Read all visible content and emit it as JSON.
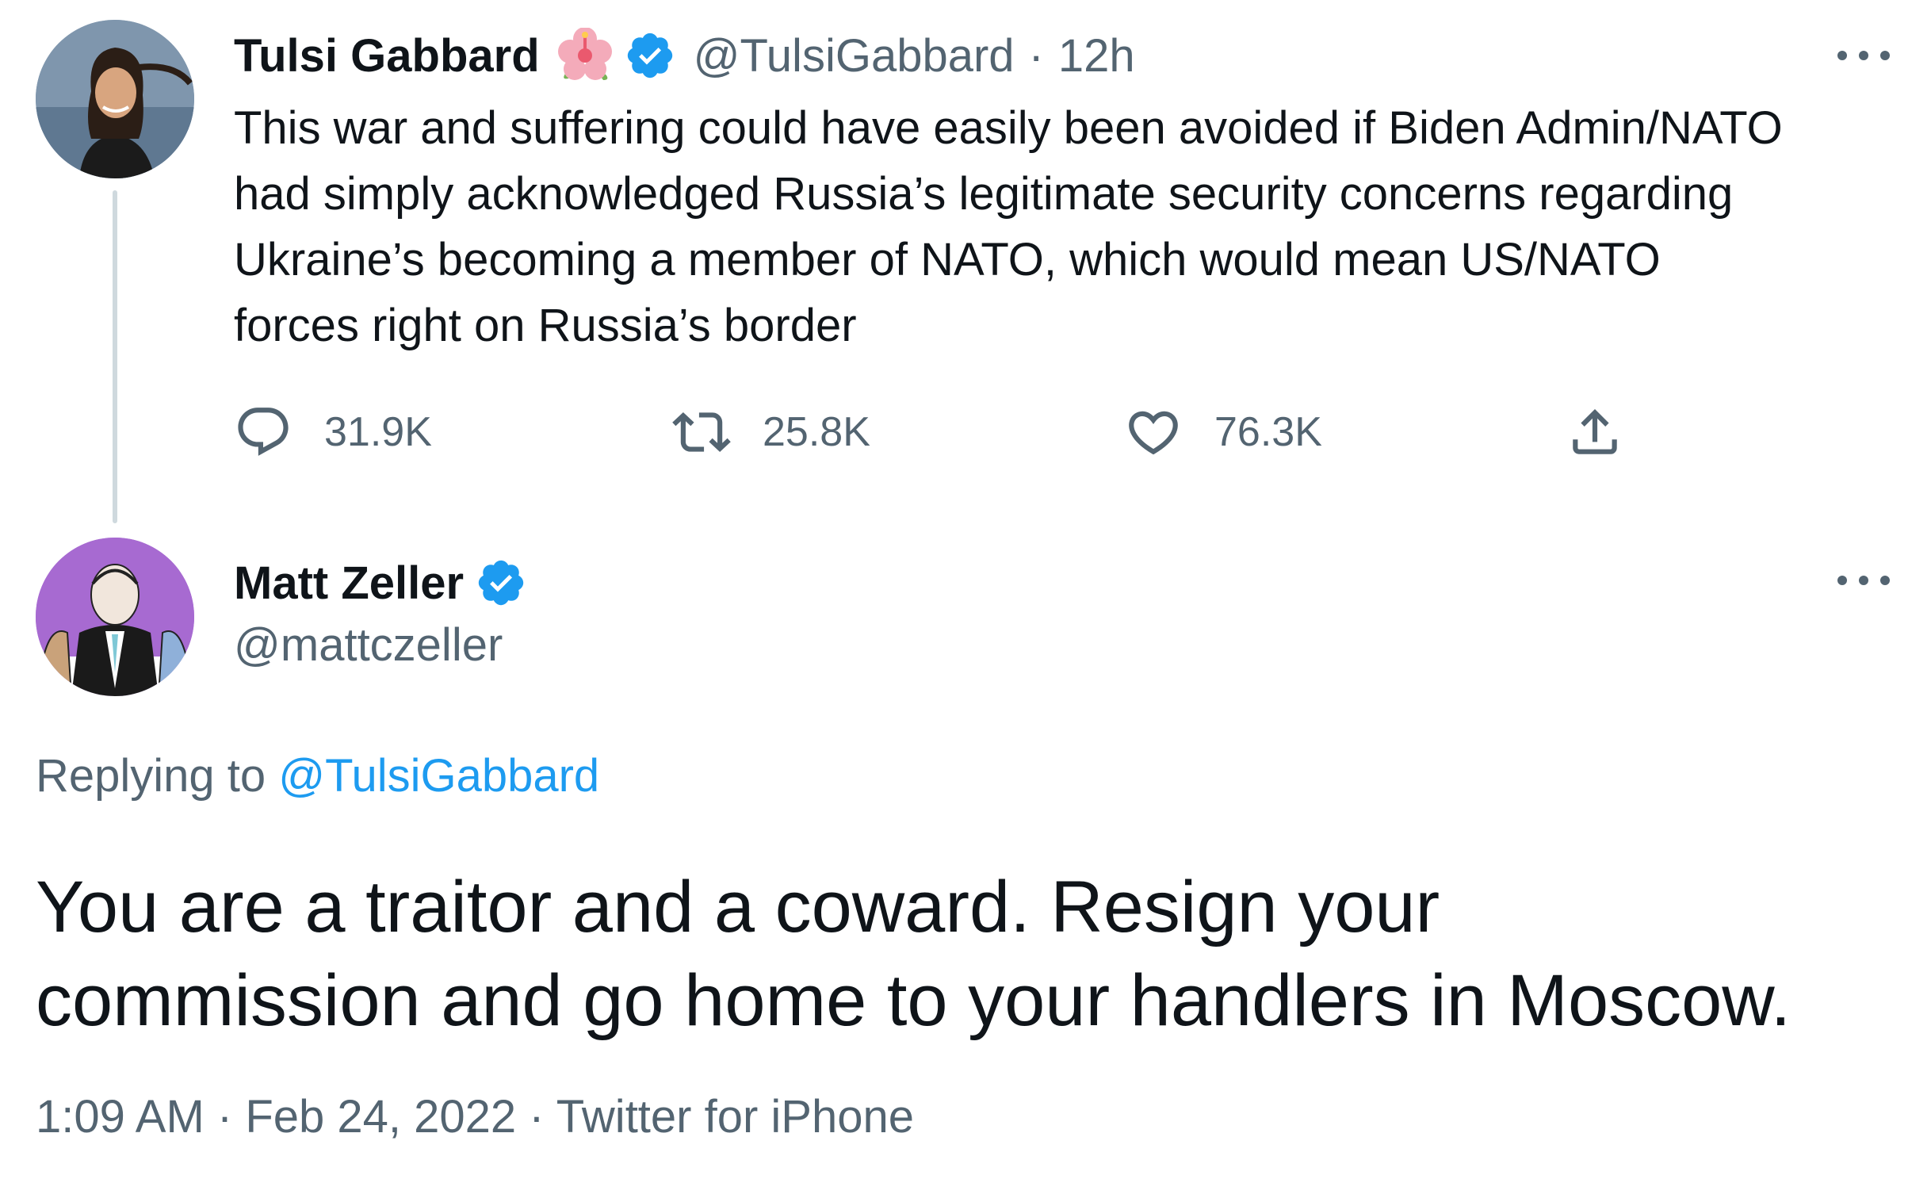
{
  "parent_tweet": {
    "display_name": "Tulsi Gabbard",
    "name_emoji": "hibiscus-emoji",
    "verified": true,
    "handle": "@TulsiGabbard",
    "separator": "·",
    "age": "12h",
    "text": "This war and suffering could have easily been avoided if Biden Admin/NATO\nhad simply acknowledged Russia’s legitimate security concerns regarding\nUkraine’s becoming a member of NATO, which would mean US/NATO\nforces right on Russia’s border",
    "actions": {
      "replies": "31.9K",
      "retweets": "25.8K",
      "likes": "76.3K"
    }
  },
  "reply_tweet": {
    "display_name": "Matt Zeller",
    "verified": true,
    "handle": "@mattczeller",
    "replying_prefix": "Replying to ",
    "replying_to": "@TulsiGabbard",
    "text": "You are a traitor and a coward. Resign your\ncommission and go home to your handlers in Moscow.",
    "time": "1:09 AM",
    "separator_1": " · ",
    "date": "Feb 24, 2022",
    "separator_2": " · ",
    "source": "Twitter for iPhone"
  },
  "colors": {
    "text_primary": "#0f1419",
    "text_secondary": "#536471",
    "link": "#1d9bf0",
    "verified_badge": "#1d9bf0",
    "thread_line": "#cfd9de"
  }
}
